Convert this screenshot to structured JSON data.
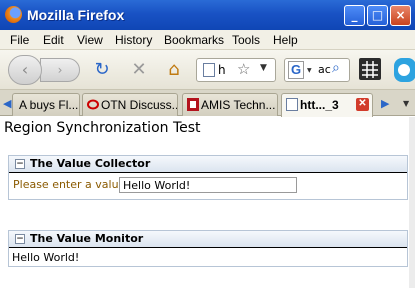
{
  "window": {
    "title": "Mozilla Firefox",
    "buttons": {
      "minimize": "_",
      "maximize": "□",
      "close": "×"
    }
  },
  "menu": [
    "File",
    "Edit",
    "View",
    "History",
    "Bookmarks",
    "Tools",
    "Help"
  ],
  "toolbar": {
    "back_glyph": "‹",
    "forward_glyph": "›",
    "url_value": "h",
    "search_engine": "G",
    "search_value": "ac"
  },
  "tabs": [
    {
      "label": "A buys Fl...",
      "active": false
    },
    {
      "label": "OTN Discuss...",
      "active": false
    },
    {
      "label": "AMIS Techn...",
      "active": false
    },
    {
      "label": "htt..._3",
      "active": true
    }
  ],
  "page": {
    "title": "Region Synchronization Test",
    "collector": {
      "heading": "The Value Collector",
      "label": "Please enter a value",
      "value": "Hello World!"
    },
    "monitor": {
      "heading": "The Value Monitor",
      "text": "Hello World!"
    }
  },
  "colors": {
    "titlebar": "#1952c4",
    "label": "#8a5a00",
    "region_border": "#b7c5d6"
  }
}
